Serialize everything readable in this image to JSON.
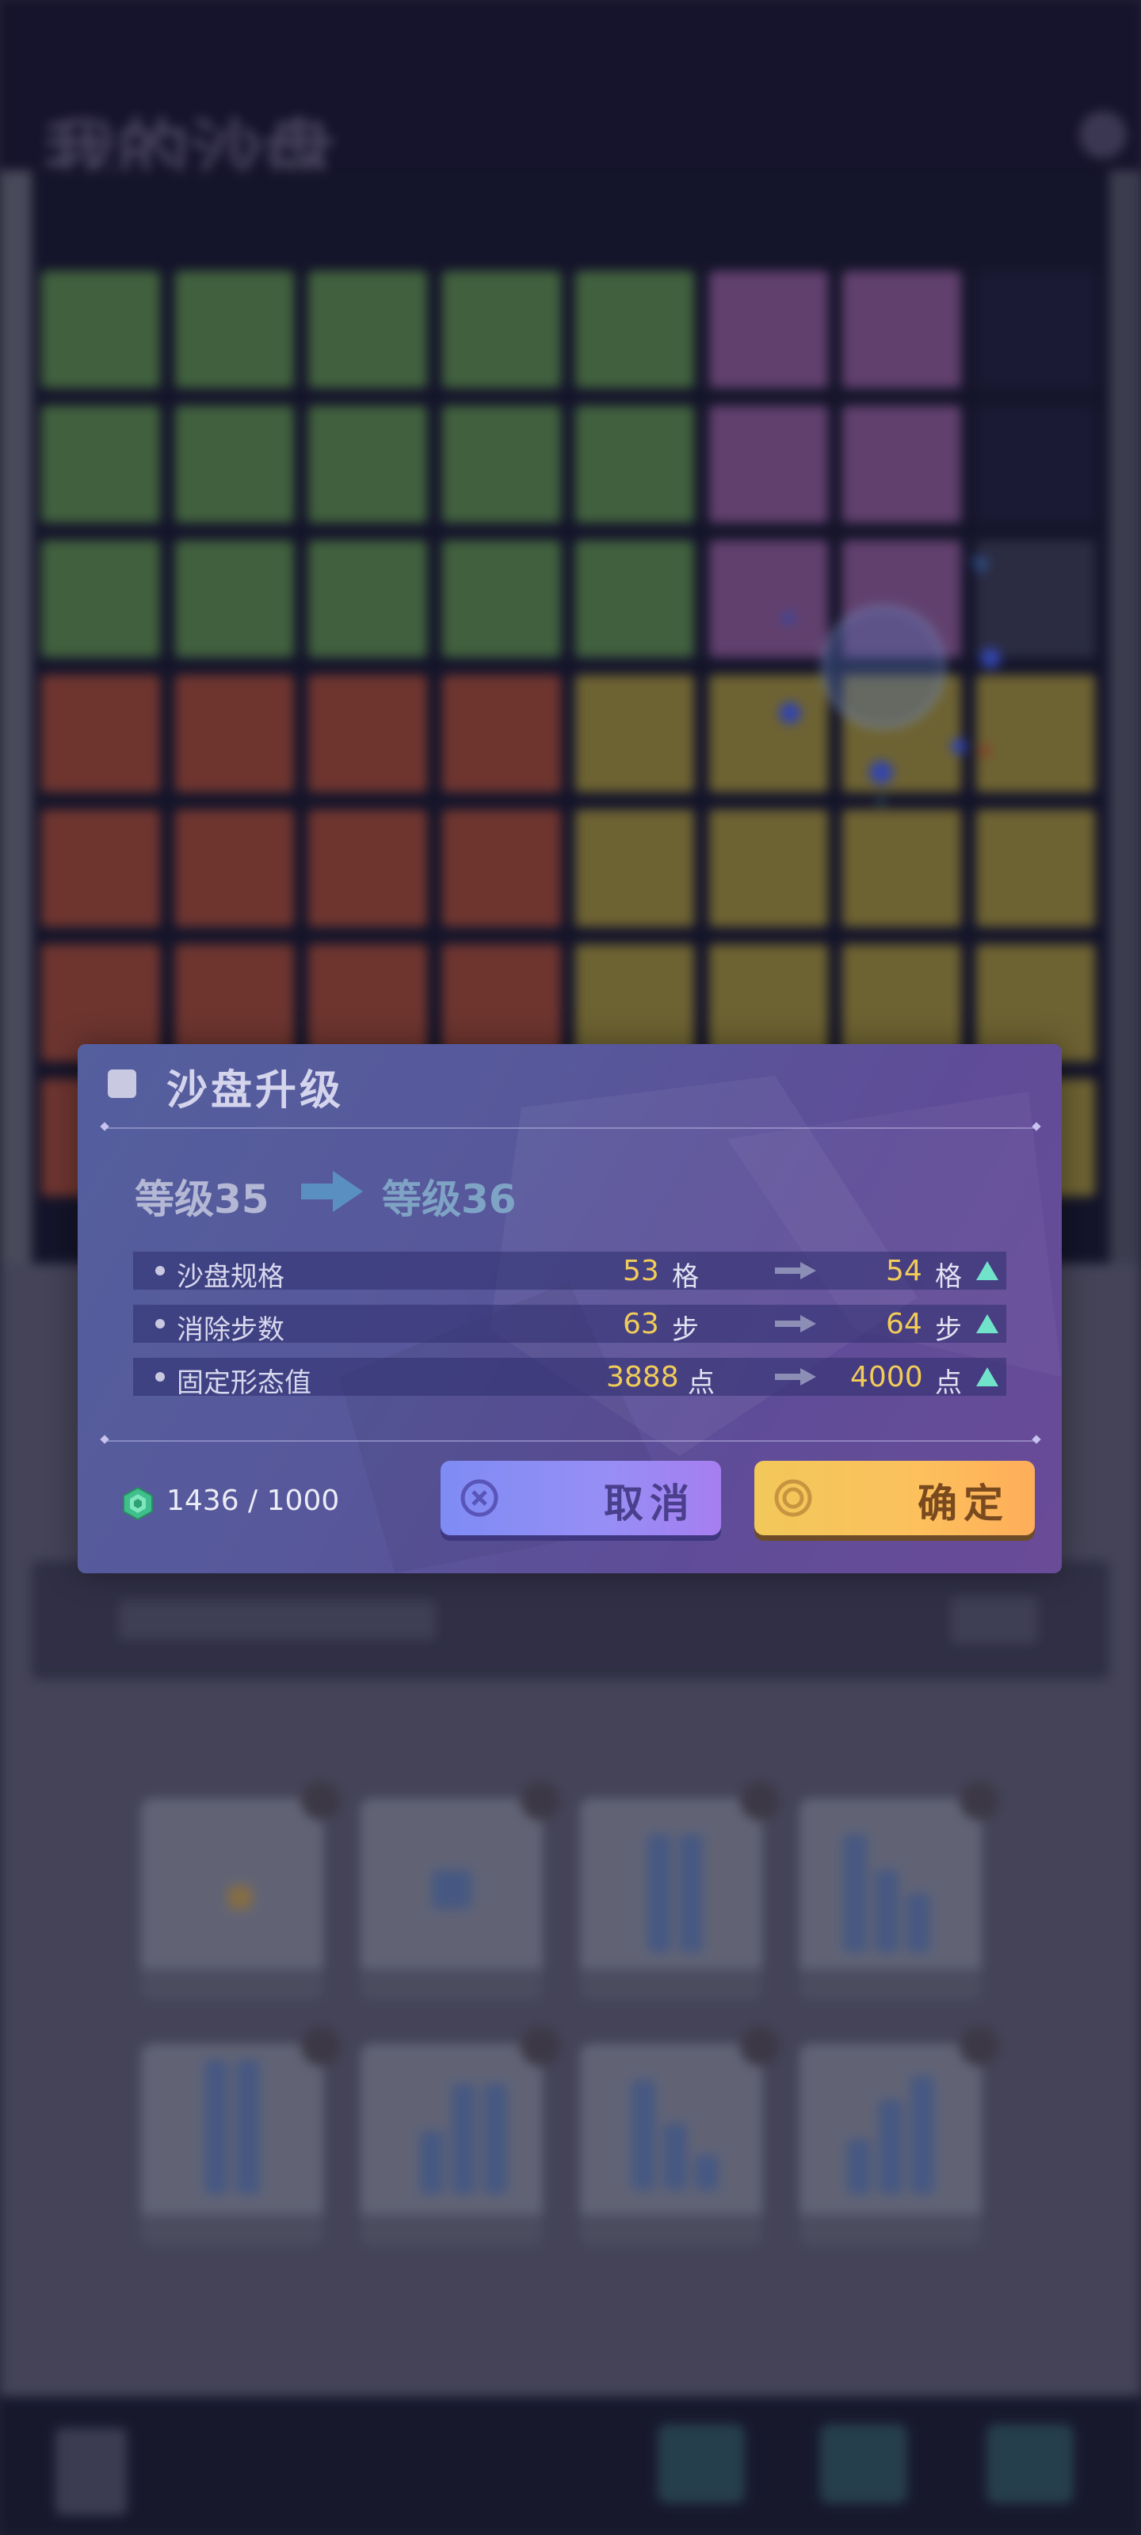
{
  "background": {
    "title": "我的沙盘"
  },
  "dialog": {
    "title": "沙盘升级",
    "level_from": "等级35",
    "level_to": "等级36",
    "rows": [
      {
        "label": "沙盘规格",
        "from_value": "53",
        "from_unit": "格",
        "to_value": "54",
        "to_unit": "格"
      },
      {
        "label": "消除步数",
        "from_value": "63",
        "from_unit": "步",
        "to_value": "64",
        "to_unit": "步"
      },
      {
        "label": "固定形态值",
        "from_value": "3888",
        "from_unit": "点",
        "to_value": "4000",
        "to_unit": "点"
      }
    ],
    "resource": "1436 / 1000",
    "cancel_label": "取消",
    "confirm_label": "确定"
  },
  "colors": {
    "value_yellow": "#f2cc58",
    "increase_teal": "#72e3cb",
    "cancel_purple": "#978ef5",
    "confirm_orange": "#fcc05c"
  }
}
